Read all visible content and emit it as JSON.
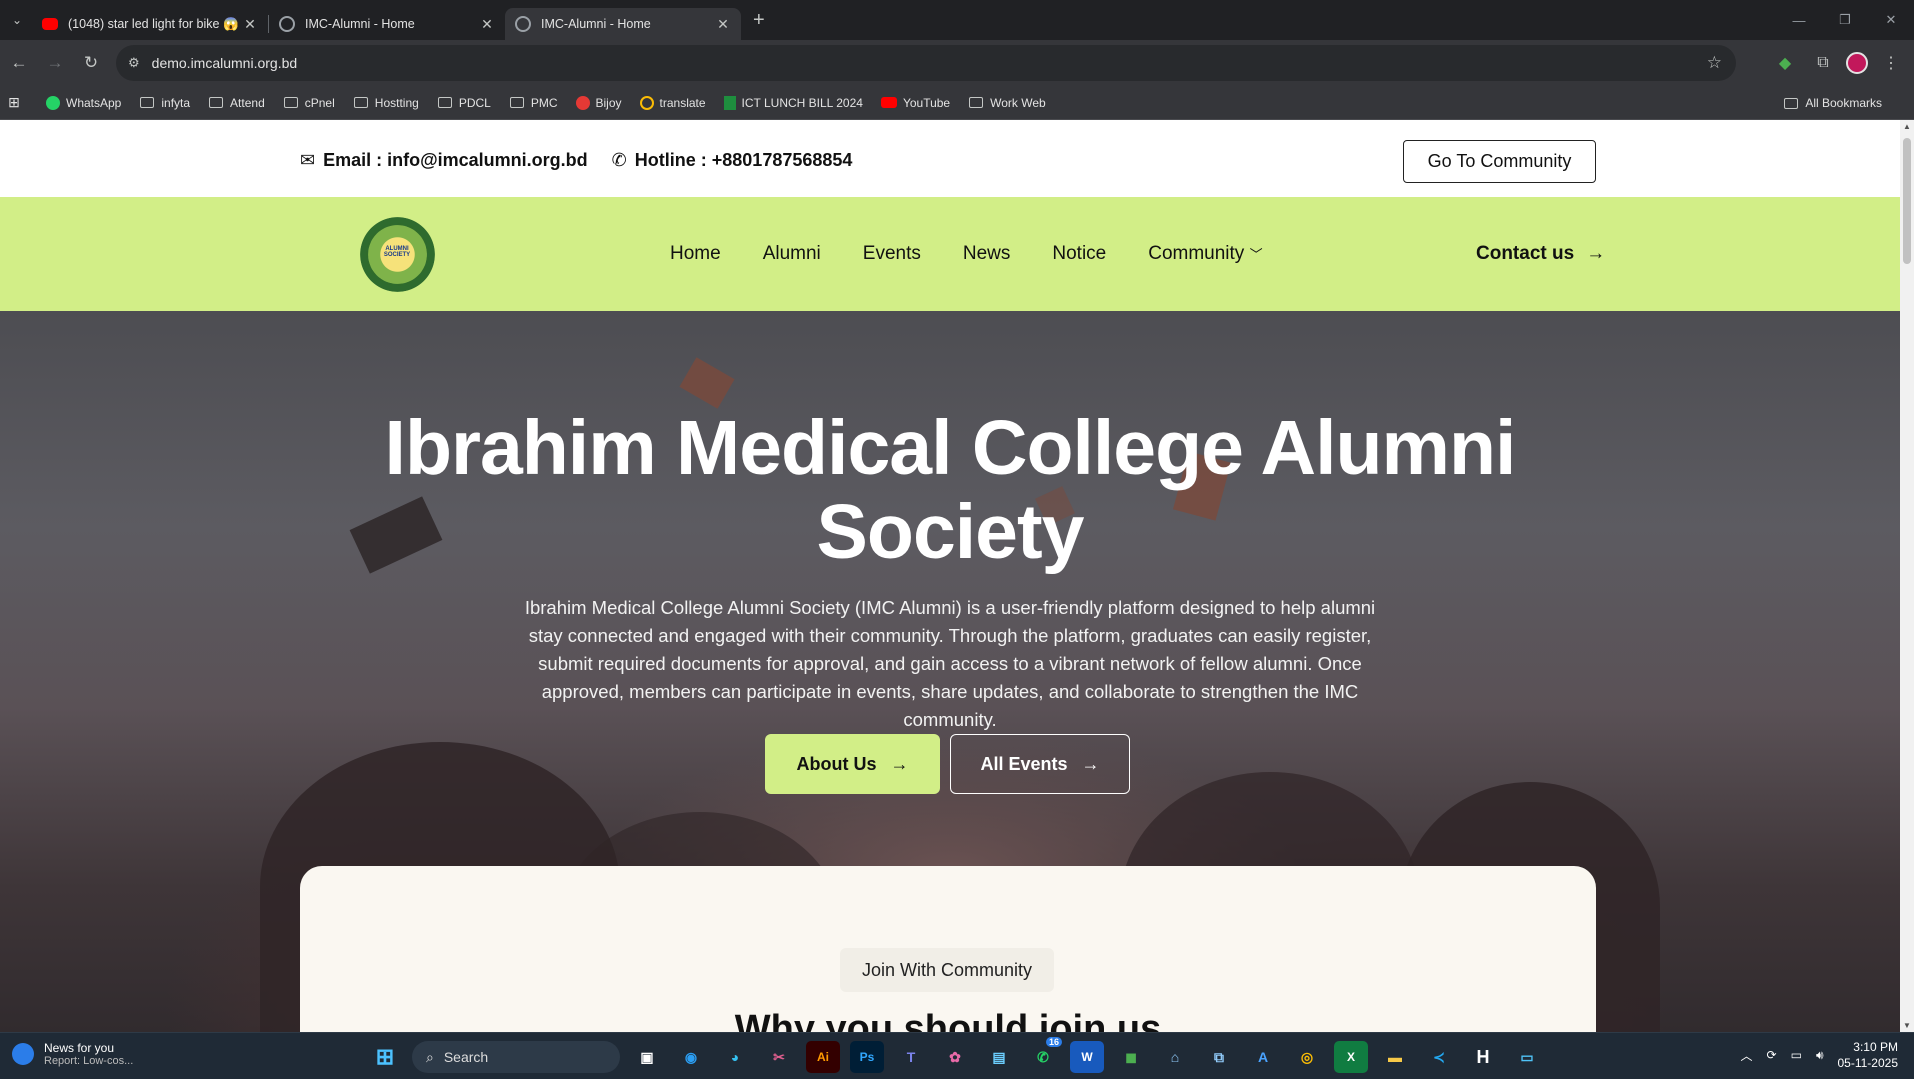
{
  "browser": {
    "tabs": [
      {
        "title": "(1048) star led light for bike 😱",
        "favicon_color": "#ff0000"
      },
      {
        "title": "IMC-Alumni - Home",
        "favicon_color": "#9aa0a6"
      },
      {
        "title": "IMC-Alumni - Home",
        "favicon_color": "#9aa0a6"
      }
    ],
    "url": "demo.imcalumni.org.bd",
    "bookmarks": [
      "WhatsApp",
      "infyta",
      "Attend",
      "cPnel",
      "Hostting",
      "PDCL",
      "PMC",
      "Bijoy",
      "translate",
      "ICT LUNCH BILL 2024",
      "YouTube",
      "Work Web"
    ],
    "all_bookmarks": "All Bookmarks"
  },
  "topbar": {
    "email": "Email : info@imcalumni.org.bd",
    "hotline": "Hotline : +8801787568854",
    "cta": "Go To Community"
  },
  "nav": {
    "logo_text": "ALUMNI SOCIETY",
    "items": [
      "Home",
      "Alumni",
      "Events",
      "News",
      "Notice",
      "Community"
    ],
    "contact": "Contact us"
  },
  "hero": {
    "title_line1": "Ibrahim Medical College Alumni",
    "title_line2": "Society",
    "description": "Ibrahim Medical College Alumni Society (IMC Alumni) is a user-friendly platform designed to help alumni stay connected and engaged with their community. Through the platform, graduates can easily register, submit required documents for approval, and gain access to a vibrant network of fellow alumni. Once approved, members can participate in events, share updates, and collaborate to strengthen the IMC community.",
    "btn_about": "About Us",
    "btn_events": "All Events"
  },
  "section": {
    "pill": "Join With Community",
    "heading": "Why you should join us"
  },
  "taskbar": {
    "news_title": "News for you",
    "news_sub": "Report: Low-cos...",
    "search": "Search",
    "badge": "16",
    "time": "3:10 PM",
    "date": "05-11-2025"
  },
  "colors": {
    "accent": "#d2ee87"
  }
}
